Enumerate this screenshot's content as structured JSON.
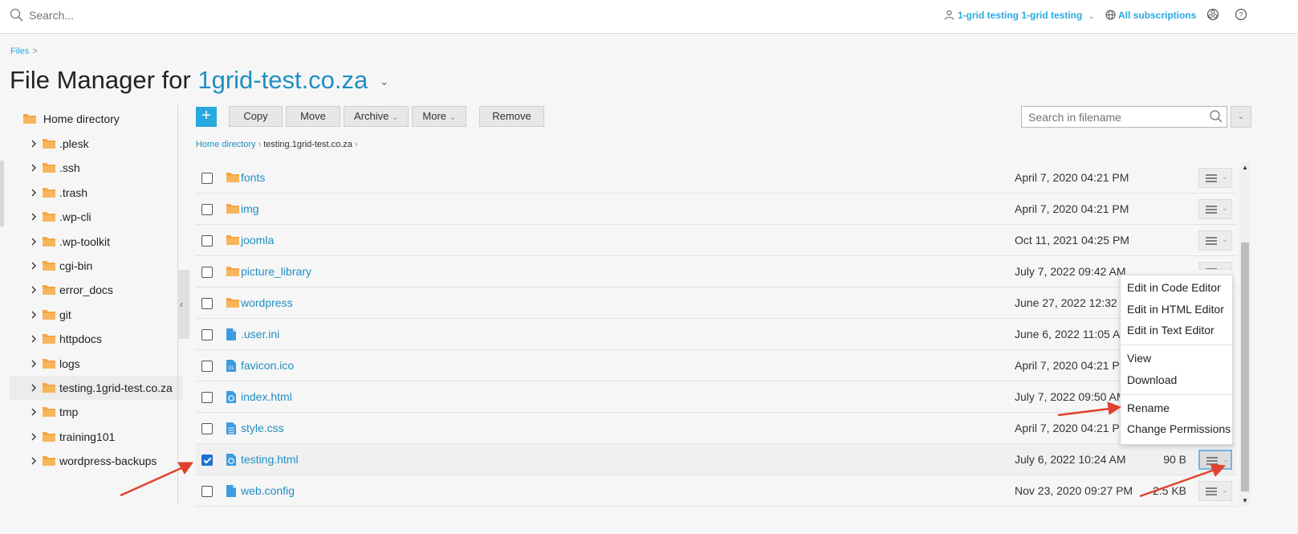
{
  "topbar": {
    "search_placeholder": "Search...",
    "user_label": "1-grid testing 1-grid testing",
    "subscriptions_label": "All subscriptions"
  },
  "top_breadcrumb": {
    "files": "Files",
    "sep": ">"
  },
  "title": {
    "prefix": "File Manager for",
    "domain": "1grid-test.co.za",
    "caret": "⌄"
  },
  "sidebar": {
    "root": "Home directory",
    "items": [
      {
        "label": ".plesk"
      },
      {
        "label": ".ssh"
      },
      {
        "label": ".trash"
      },
      {
        "label": ".wp-cli"
      },
      {
        "label": ".wp-toolkit"
      },
      {
        "label": "cgi-bin"
      },
      {
        "label": "error_docs"
      },
      {
        "label": "git"
      },
      {
        "label": "httpdocs"
      },
      {
        "label": "logs"
      },
      {
        "label": "testing.1grid-test.co.za"
      },
      {
        "label": "tmp"
      },
      {
        "label": "training101"
      },
      {
        "label": "wordpress-backups"
      }
    ],
    "selected_index": 10
  },
  "toolbar": {
    "add_label": "+",
    "copy_label": "Copy",
    "move_label": "Move",
    "archive_label": "Archive",
    "more_label": "More",
    "remove_label": "Remove",
    "search_placeholder": "Search in filename"
  },
  "breadcrumb": {
    "home": "Home directory",
    "current": "testing.1grid-test.co.za"
  },
  "files": [
    {
      "name": "fonts",
      "type": "folder",
      "date": "April 7, 2020 04:21 PM",
      "size": "",
      "checked": false
    },
    {
      "name": "img",
      "type": "folder",
      "date": "April 7, 2020 04:21 PM",
      "size": "",
      "checked": false
    },
    {
      "name": "joomla",
      "type": "folder",
      "date": "Oct 11, 2021 04:25 PM",
      "size": "",
      "checked": false
    },
    {
      "name": "picture_library",
      "type": "folder",
      "date": "July 7, 2022 09:42 AM",
      "size": "",
      "checked": false
    },
    {
      "name": "wordpress",
      "type": "folder",
      "date": "June 27, 2022 12:32 PM",
      "size": "",
      "checked": false
    },
    {
      "name": ".user.ini",
      "type": "file",
      "date": "June 6, 2022 11:05 AM",
      "size": "",
      "checked": false
    },
    {
      "name": "favicon.ico",
      "type": "bin",
      "date": "April 7, 2020 04:21 PM",
      "size": "",
      "checked": false
    },
    {
      "name": "index.html",
      "type": "html",
      "date": "July 7, 2022 09:50 AM",
      "size": "",
      "checked": false
    },
    {
      "name": "style.css",
      "type": "css",
      "date": "April 7, 2020 04:21 PM",
      "size": "",
      "checked": false
    },
    {
      "name": "testing.html",
      "type": "html",
      "date": "July 6, 2022 10:24 AM",
      "size": "90 B",
      "checked": true
    },
    {
      "name": "web.config",
      "type": "file",
      "date": "Nov 23, 2020 09:27 PM",
      "size": "2.5 KB",
      "checked": false
    }
  ],
  "context_menu": {
    "edit_code": "Edit in Code Editor",
    "edit_html": "Edit in HTML Editor",
    "edit_text": "Edit in Text Editor",
    "view": "View",
    "download": "Download",
    "rename": "Rename",
    "change_permissions": "Change Permissions"
  },
  "colors": {
    "accent": "#28aade",
    "link": "#1e8fc4",
    "folder": "#f5a641",
    "file_blue": "#3d9be0",
    "annotation_arrow": "#e0412e"
  }
}
